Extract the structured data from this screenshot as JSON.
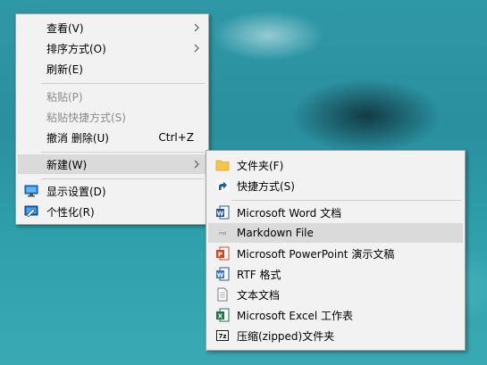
{
  "main_menu": {
    "view": "查看(V)",
    "sort": "排序方式(O)",
    "refresh": "刷新(E)",
    "paste": "粘贴(P)",
    "paste_shortcut": "粘贴快捷方式(S)",
    "undo_delete": "撤消 删除(U)",
    "undo_shortcut": "Ctrl+Z",
    "new": "新建(W)",
    "display_settings": "显示设置(D)",
    "personalize": "个性化(R)"
  },
  "new_submenu": {
    "folder": "文件夹(F)",
    "shortcut": "快捷方式(S)",
    "word": "Microsoft Word 文档",
    "markdown": "Markdown File",
    "powerpoint": "Microsoft PowerPoint 演示文稿",
    "rtf": "RTF 格式",
    "text": "文本文档",
    "excel": "Microsoft Excel 工作表",
    "zip": "压缩(zipped)文件夹"
  },
  "icons": {
    "display_settings": "monitor-icon",
    "personalize": "personalize-icon",
    "folder": "folder-icon",
    "shortcut": "shortcut-arrow-icon",
    "word": "word-doc-icon",
    "markdown": "markdown-icon",
    "powerpoint": "powerpoint-icon",
    "rtf": "rtf-doc-icon",
    "text": "text-doc-icon",
    "excel": "excel-icon",
    "zip": "7zip-icon"
  },
  "colors": {
    "menu_bg": "#f2f2f2",
    "hover_bg": "#dadada",
    "disabled_text": "#8c8c8c",
    "word": "#2b579a",
    "powerpoint": "#d24726",
    "excel": "#217346",
    "folder": "#f5c54a"
  }
}
